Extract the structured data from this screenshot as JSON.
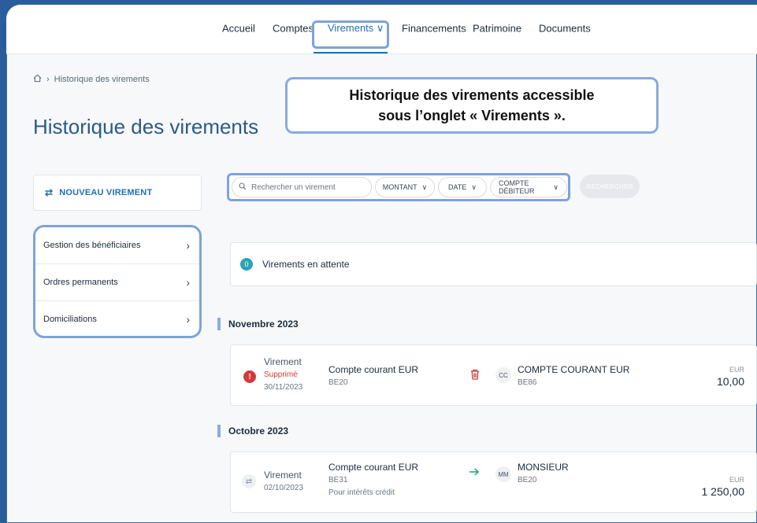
{
  "nav": {
    "items": [
      {
        "label": "Accueil"
      },
      {
        "label": "Comptes"
      },
      {
        "label": "Virements ∨"
      },
      {
        "label": "Financements"
      },
      {
        "label": "Patrimoine"
      },
      {
        "label": "Documents"
      }
    ]
  },
  "breadcrumb": {
    "home_icon": "home-icon",
    "separator": "›",
    "current": "Historique des virements"
  },
  "page": {
    "title": "Historique des virements"
  },
  "callout": {
    "line1": "Historique des virements accessible",
    "line2": "sous l’onglet « Virements »."
  },
  "sidebar": {
    "new_transfer": "NOUVEAU VIREMENT",
    "items": [
      {
        "label": "Gestion des bénéficiaires"
      },
      {
        "label": "Ordres permanents"
      },
      {
        "label": "Domiciliations"
      }
    ]
  },
  "filters": {
    "search_placeholder": "Rechercher un virement",
    "montant": "MONTANT",
    "date": "DATE",
    "compte": "COMPTE DÉBITEUR",
    "search_button": "RECHERCHER"
  },
  "pending": {
    "count": "0",
    "label": "Virements en attente"
  },
  "groups": [
    {
      "month": "Novembre 2023",
      "tx": {
        "type": "Virement",
        "status": "Supprimé",
        "date": "30/11/2023",
        "from_name": "Compte courant EUR",
        "from_iban": "BE20",
        "to_initials": "CC",
        "to_name": "COMPTE COURANT EUR",
        "to_iban": "BE86",
        "currency": "EUR",
        "amount": "10,00"
      }
    },
    {
      "month": "Octobre 2023",
      "tx": {
        "type": "Virement",
        "date": "02/10/2023",
        "from_name": "Compte courant EUR",
        "from_iban": "BE31",
        "memo": "Pour intérêts crédit",
        "to_initials": "MM",
        "to_name": "MONSIEUR",
        "to_iban": "BE20",
        "currency": "EUR",
        "amount": "1 250,00"
      }
    }
  ],
  "colors": {
    "accent": "#1f6fb5",
    "highlight": "#7ea3d8",
    "error": "#d23b3b",
    "badge": "#2aa3b8",
    "transfer_arrow": "#1aa37a"
  }
}
